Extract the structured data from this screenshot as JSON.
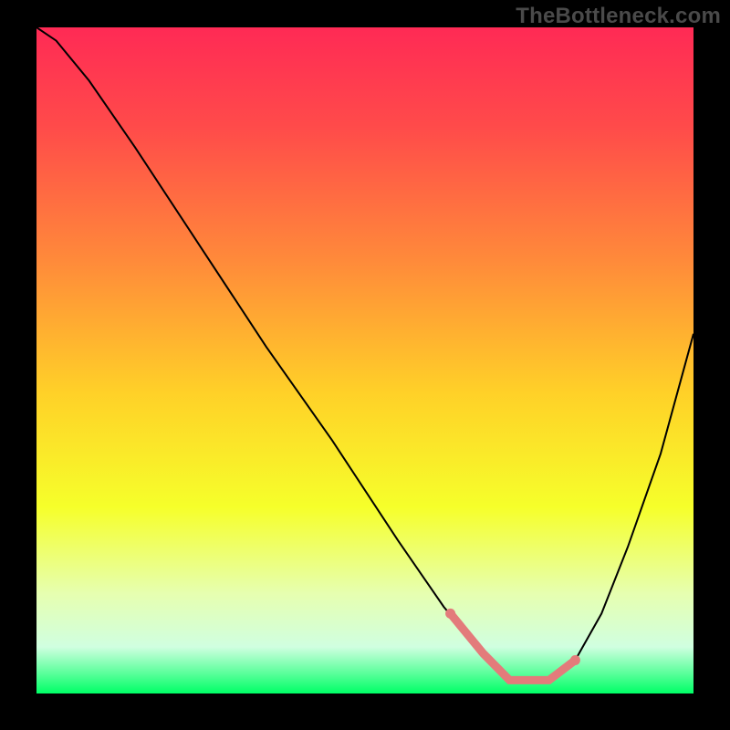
{
  "watermark": "TheBottleneck.com",
  "chart_data": {
    "type": "line",
    "title": "",
    "xlabel": "",
    "ylabel": "",
    "xlim": [
      0,
      100
    ],
    "ylim": [
      0,
      100
    ],
    "grid": false,
    "legend": false,
    "background_gradient": {
      "stops": [
        {
          "offset": 0.0,
          "color": "#ff2a55"
        },
        {
          "offset": 0.15,
          "color": "#ff4b4a"
        },
        {
          "offset": 0.35,
          "color": "#ff8a3a"
        },
        {
          "offset": 0.55,
          "color": "#ffd128"
        },
        {
          "offset": 0.72,
          "color": "#f6ff2a"
        },
        {
          "offset": 0.85,
          "color": "#e6ffb0"
        },
        {
          "offset": 0.93,
          "color": "#d0ffe0"
        },
        {
          "offset": 1.0,
          "color": "#00ff66"
        }
      ]
    },
    "series": [
      {
        "name": "bottleneck-curve",
        "stroke": "#000000",
        "stroke_width": 2,
        "x": [
          0,
          3,
          8,
          15,
          25,
          35,
          45,
          55,
          62,
          68,
          72,
          78,
          82,
          86,
          90,
          95,
          100
        ],
        "y": [
          100,
          98,
          92,
          82,
          67,
          52,
          38,
          23,
          13,
          6,
          2,
          2,
          5,
          12,
          22,
          36,
          54
        ]
      }
    ],
    "highlight": {
      "name": "optimal-range",
      "stroke": "#e37b7b",
      "stroke_width": 9,
      "x": [
        63,
        68,
        72,
        78,
        82
      ],
      "y": [
        12,
        6,
        2,
        2,
        5
      ],
      "endpoints": true
    }
  }
}
